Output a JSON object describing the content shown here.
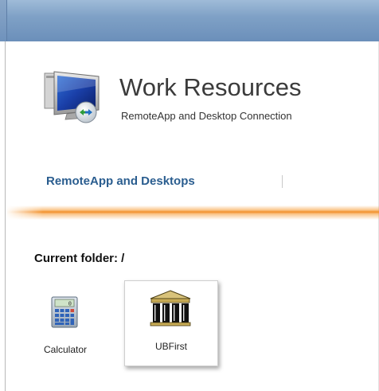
{
  "header": {
    "title": "Work Resources",
    "subtitle": "RemoteApp and Desktop Connection",
    "logo_icon": "remote-desktop-monitor-icon"
  },
  "nav": {
    "items": [
      {
        "label": "RemoteApp and Desktops"
      }
    ]
  },
  "folder": {
    "label": "Current folder: /"
  },
  "apps": [
    {
      "label": "Calculator",
      "icon": "calculator-icon"
    },
    {
      "label": "UBFirst",
      "icon": "building-columns-icon"
    }
  ],
  "colors": {
    "nav_link": "#2a5d8f",
    "accent_orange": "#f2902a",
    "top_bar": "#7fa1c6"
  }
}
